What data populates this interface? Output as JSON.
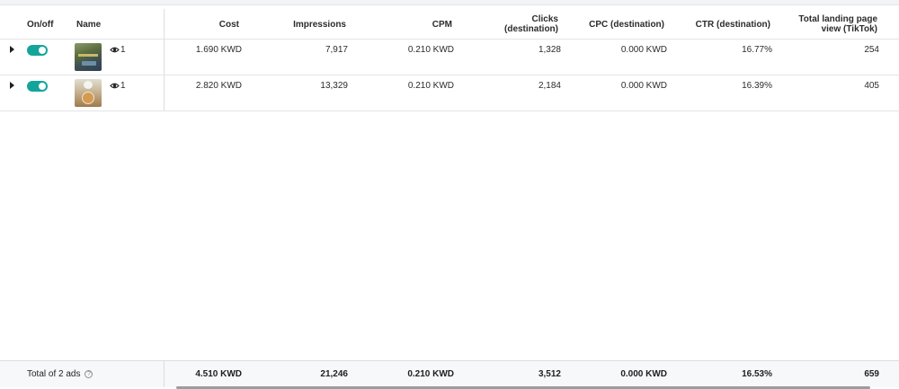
{
  "columns": {
    "onoff": "On/off",
    "name": "Name",
    "cost": "Cost",
    "impressions": "Impressions",
    "cpm": "CPM",
    "clicks_l1": "Clicks",
    "clicks_l2": "(destination)",
    "cpc": "CPC (destination)",
    "ctr": "CTR (destination)",
    "landing_l1": "Total landing page",
    "landing_l2": "view (TikTok)"
  },
  "rows": [
    {
      "toggle_on": true,
      "preview_count": "1",
      "cost": "1.690 KWD",
      "impressions": "7,917",
      "cpm": "0.210 KWD",
      "clicks": "1,328",
      "cpc": "0.000 KWD",
      "ctr": "16.77%",
      "landing": "254"
    },
    {
      "toggle_on": true,
      "preview_count": "1",
      "cost": "2.820 KWD",
      "impressions": "13,329",
      "cpm": "0.210 KWD",
      "clicks": "2,184",
      "cpc": "0.000 KWD",
      "ctr": "16.39%",
      "landing": "405"
    }
  ],
  "totals": {
    "label": "Total of 2 ads",
    "help_glyph": "?",
    "cost": "4.510 KWD",
    "impressions": "21,246",
    "cpm": "0.210 KWD",
    "clicks": "3,512",
    "cpc": "0.000 KWD",
    "ctr": "16.53%",
    "landing": "659"
  },
  "colors": {
    "toggle_on": "#14a59a"
  },
  "icons": {
    "expand": "caret-right-icon",
    "preview": "eye-icon"
  }
}
